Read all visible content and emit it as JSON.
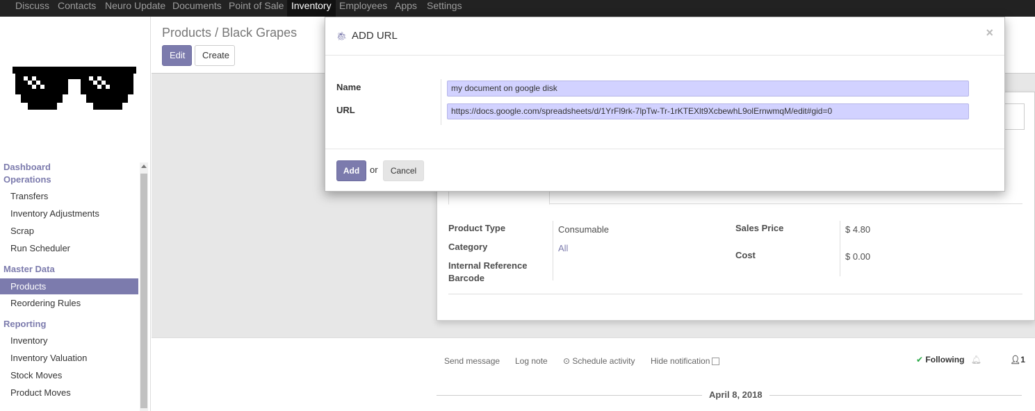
{
  "topbar": {
    "items": [
      "Discuss",
      "Contacts",
      "Neuro Update",
      "Documents",
      "Point of Sale",
      "Inventory",
      "Employees",
      "Apps",
      "Settings"
    ],
    "active": "Inventory"
  },
  "sidebar": {
    "sections": [
      {
        "title": "Dashboard"
      },
      {
        "title": "Operations",
        "items": [
          "Transfers",
          "Inventory Adjustments",
          "Scrap",
          "Run Scheduler"
        ]
      },
      {
        "title": "Master Data",
        "items": [
          "Products",
          "Reordering Rules"
        ]
      },
      {
        "title": "Reporting",
        "items": [
          "Inventory",
          "Inventory Valuation",
          "Stock Moves",
          "Product Moves"
        ]
      }
    ],
    "active_item": "Products"
  },
  "control_panel": {
    "breadcrumb_parent": "Products",
    "breadcrumb_sep": "/",
    "breadcrumb_current": "Black Grapes",
    "edit_label": "Edit",
    "create_label": "Create"
  },
  "form": {
    "product_type_label": "Product Type",
    "product_type_value": "Consumable",
    "category_label": "Category",
    "category_value": "All",
    "internal_reference_label": "Internal Reference",
    "barcode_label": "Barcode",
    "sales_price_label": "Sales Price",
    "sales_price_value": "$ 4.80",
    "cost_label": "Cost",
    "cost_value": "$ 0.00"
  },
  "chatter": {
    "send_message": "Send message",
    "log_note": "Log note",
    "schedule_activity": "Schedule activity",
    "hide_notification": "Hide notification",
    "following": "Following",
    "followers_count": "1",
    "date_separator": "April 8, 2018"
  },
  "modal": {
    "title": "ADD URL",
    "name_label": "Name",
    "name_value": "my document on google disk",
    "url_label": "URL",
    "url_value": "https://docs.google.com/spreadsheets/d/1YrFl9rk-7lpTw-Tr-1rKTEXlt9XcbewhL9olErnwmqM/edit#gid=0",
    "add_label": "Add",
    "or_label": "or",
    "cancel_label": "Cancel",
    "close_glyph": "×"
  },
  "colors": {
    "brand": "#7c7bad",
    "topbar": "#222222",
    "input_bg": "#d2d2ff"
  }
}
